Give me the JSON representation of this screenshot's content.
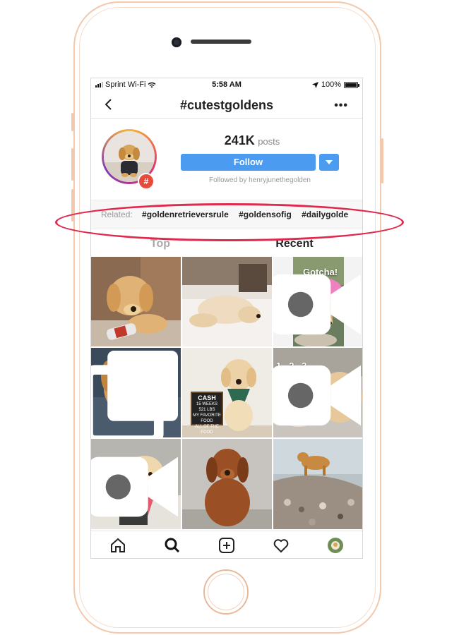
{
  "status_bar": {
    "carrier": "Sprint Wi-Fi",
    "time": "5:58 AM",
    "battery": "100%"
  },
  "header": {
    "title": "#cutestgoldens",
    "more": "•••"
  },
  "profile": {
    "posts_count": "241K",
    "posts_label": "posts",
    "follow_label": "Follow",
    "followed_by": "Followed by henryjunethegolden",
    "badge": "#"
  },
  "related": {
    "label": "Related:",
    "tags": [
      "#goldenretrieversrule",
      "#goldensofig",
      "#dailygolde"
    ]
  },
  "tabs": {
    "top": "Top",
    "recent": "Recent"
  },
  "grid": {
    "overlays": {
      "gotcha": "Gotcha!",
      "countdown": "1...2...3",
      "sign_title": "CASH",
      "sign_line1": "15 WEEKS",
      "sign_line2": "521 LBS",
      "sign_line3": "MY FAVORITE FOOD",
      "sign_line4": "ALL OF THE FOOD"
    }
  },
  "bottom_nav": [
    "home",
    "search",
    "add",
    "activity",
    "profile"
  ],
  "colors": {
    "accent": "#4b9bf0",
    "highlight": "#e0294d",
    "phone_frame": "#f2c9ac"
  }
}
